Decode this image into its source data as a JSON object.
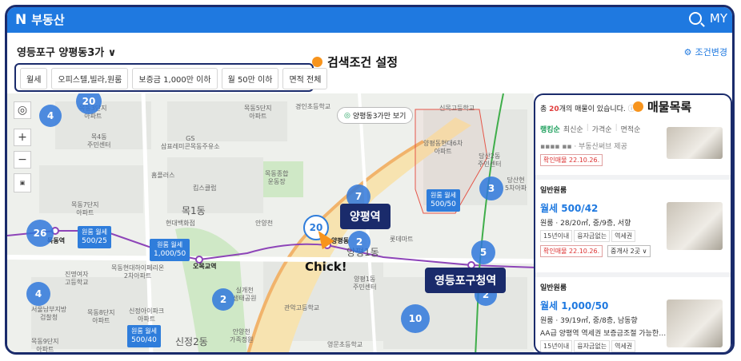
{
  "header": {
    "logo": "N",
    "title": "부동산",
    "right_label": "MY"
  },
  "location": {
    "label": "영등포구 양평동3가 ∨"
  },
  "filter_button": {
    "label": "조건변경"
  },
  "chips": [
    "월세",
    "오피스텔,빌라,원룸",
    "보증금 1,000만 이하",
    "월 50만 이하",
    "면적 전체"
  ],
  "callouts": {
    "search": "검색조건 설정",
    "list": "매물목록",
    "station1": "양평역",
    "station2": "영등포구청역",
    "chick": "Chick!"
  },
  "map": {
    "pill": "양평동3가만 보기",
    "clusters": [
      "20",
      "4",
      "26",
      "4",
      "7",
      "2",
      "3",
      "5",
      "2",
      "10",
      "2",
      "20"
    ],
    "price_boxes": [
      {
        "top": "원룸 월세",
        "bottom": "500/25"
      },
      {
        "top": "원룸 월세",
        "bottom": "1,000/50"
      },
      {
        "top": "원룸 월세",
        "bottom": "500/40"
      },
      {
        "top": "원룸 월세",
        "bottom": "500/50"
      }
    ],
    "place_labels": [
      "목동3단지\n아파트",
      "목동5단지\n아파트",
      "경인초등학교",
      "신목고등학교",
      "목4동\n주민센터",
      "목동5단지\n아파트",
      "GS\n삼표레미콘목동주유소",
      "목동7단지\n아파트",
      "목1동",
      "현대백화점",
      "목동현대하이페리온\n2차아파트",
      "진명여자\n고등학교",
      "서울남부지방\n검찰청",
      "목동9단지\n아파트",
      "신정2동",
      "안양천",
      "양평동",
      "양평1동",
      "양평1동\n주민센터",
      "관악고등학교",
      "영문초등학교",
      "양평동현대6차\n아파트",
      "당산2동\n주민센터",
      "롯데마트",
      "목동역",
      "오목교역",
      "홈플러스",
      "킴스클럽",
      "목동종합\n운동장",
      "신정아이파크\n아파트",
      "안양천\n가족정원",
      "목동8단지\n아파트",
      "목동6단지\n아파트",
      "실개천\n생태공원",
      "당산현\n5차아파"
    ]
  },
  "panel": {
    "count_prefix": "총",
    "count": "20",
    "count_suffix": "개의 매물이 있습니다.",
    "tabs": [
      "랭킹순",
      "최신순",
      "가격순",
      "면적순"
    ],
    "item0": {
      "provider": "부동산써브 제공",
      "confirmed": "확인매물 22.10.26."
    },
    "section1": "일반원룸",
    "item1": {
      "price": "월세 500/42",
      "desc": "원룸 · 28/20㎡, 중/9층, 서향",
      "tags": [
        "15년이내",
        "융자금없는",
        "역세권"
      ],
      "confirmed": "확인매물 22.10.26.",
      "agents": "중개사 2곳 ∨"
    },
    "section2": "일반원룸",
    "item2": {
      "price": "월세 1,000/50",
      "desc": "원룸 · 39/19㎡, 중/8층, 남동향",
      "note": "AA급 양평역 역세권 보증금조절 가능한…",
      "tags": [
        "15년이내",
        "융자금없는",
        "역세권"
      ]
    }
  }
}
